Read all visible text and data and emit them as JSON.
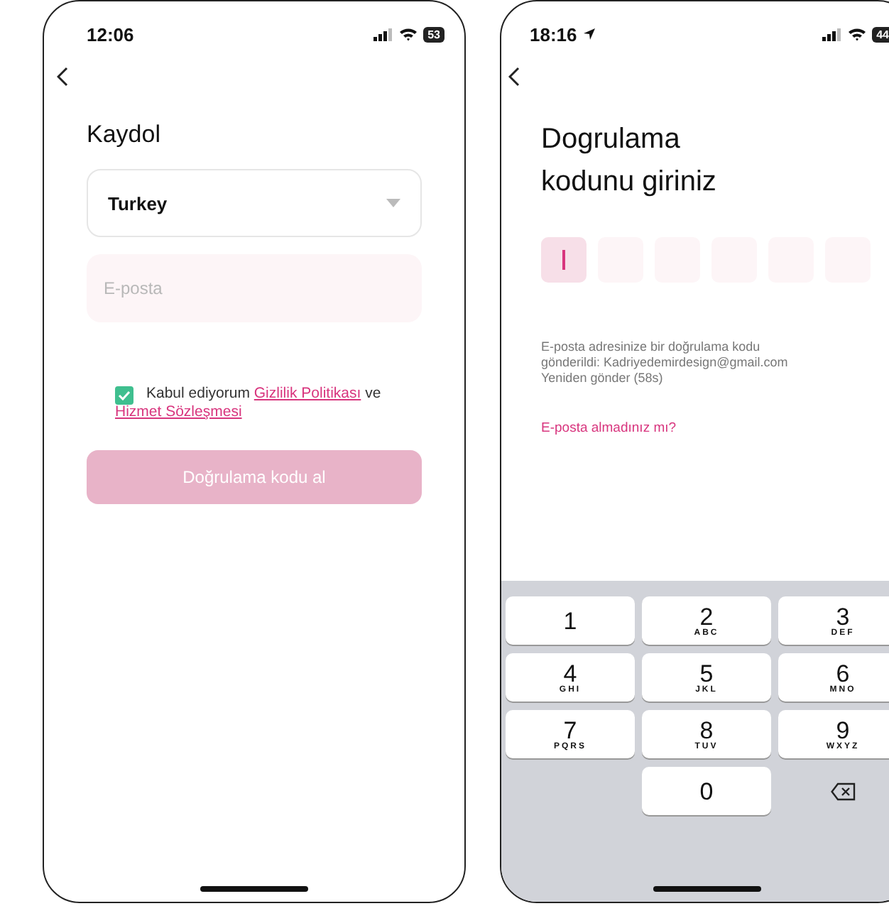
{
  "signup_screen": {
    "status_bar": {
      "time": "12:06",
      "battery": "53"
    },
    "title": "Kaydol",
    "country_select": {
      "value": "Turkey"
    },
    "email_field": {
      "placeholder": "E-posta"
    },
    "consent": {
      "checked": true,
      "text": "Kabul ediyorum",
      "privacy_link": "Gizlilik Politikası",
      "conjunction": "ve",
      "terms_link": "Hizmet Sözleşmesi"
    },
    "submit_button": {
      "label": "Doğrulama kodu al",
      "disabled": true
    }
  },
  "verify_screen": {
    "status_bar": {
      "time": "18:16",
      "battery": "44"
    },
    "title_lines": [
      "Dogrulama",
      "kodunu giriniz"
    ],
    "code_boxes": [
      {
        "selected": true
      },
      {
        "selected": false
      },
      {
        "selected": false
      },
      {
        "selected": false
      },
      {
        "selected": false
      },
      {
        "selected": false
      }
    ],
    "info_lines": [
      "E-posta adresinize bir doğrulama kodu",
      "gönderildi: Kadriyedemirdesign@gmail.com"
    ],
    "resend": "Yeniden gönder (58s)",
    "no_email_link": "E-posta almadınız mı?",
    "keypad": [
      {
        "kind": "digit",
        "digit": "1"
      },
      {
        "kind": "digit",
        "digit": "2",
        "letters": "ABC"
      },
      {
        "kind": "digit",
        "digit": "3",
        "letters": "DEF"
      },
      {
        "kind": "digit",
        "digit": "4",
        "letters": "GHI"
      },
      {
        "kind": "digit",
        "digit": "5",
        "letters": "JKL"
      },
      {
        "kind": "digit",
        "digit": "6",
        "letters": "MNO"
      },
      {
        "kind": "digit",
        "digit": "7",
        "letters": "PQRS"
      },
      {
        "kind": "digit",
        "digit": "8",
        "letters": "TUV"
      },
      {
        "kind": "digit",
        "digit": "9",
        "letters": "WXYZ"
      },
      {
        "kind": "blank"
      },
      {
        "kind": "digit",
        "digit": "0"
      },
      {
        "kind": "delete"
      }
    ]
  }
}
